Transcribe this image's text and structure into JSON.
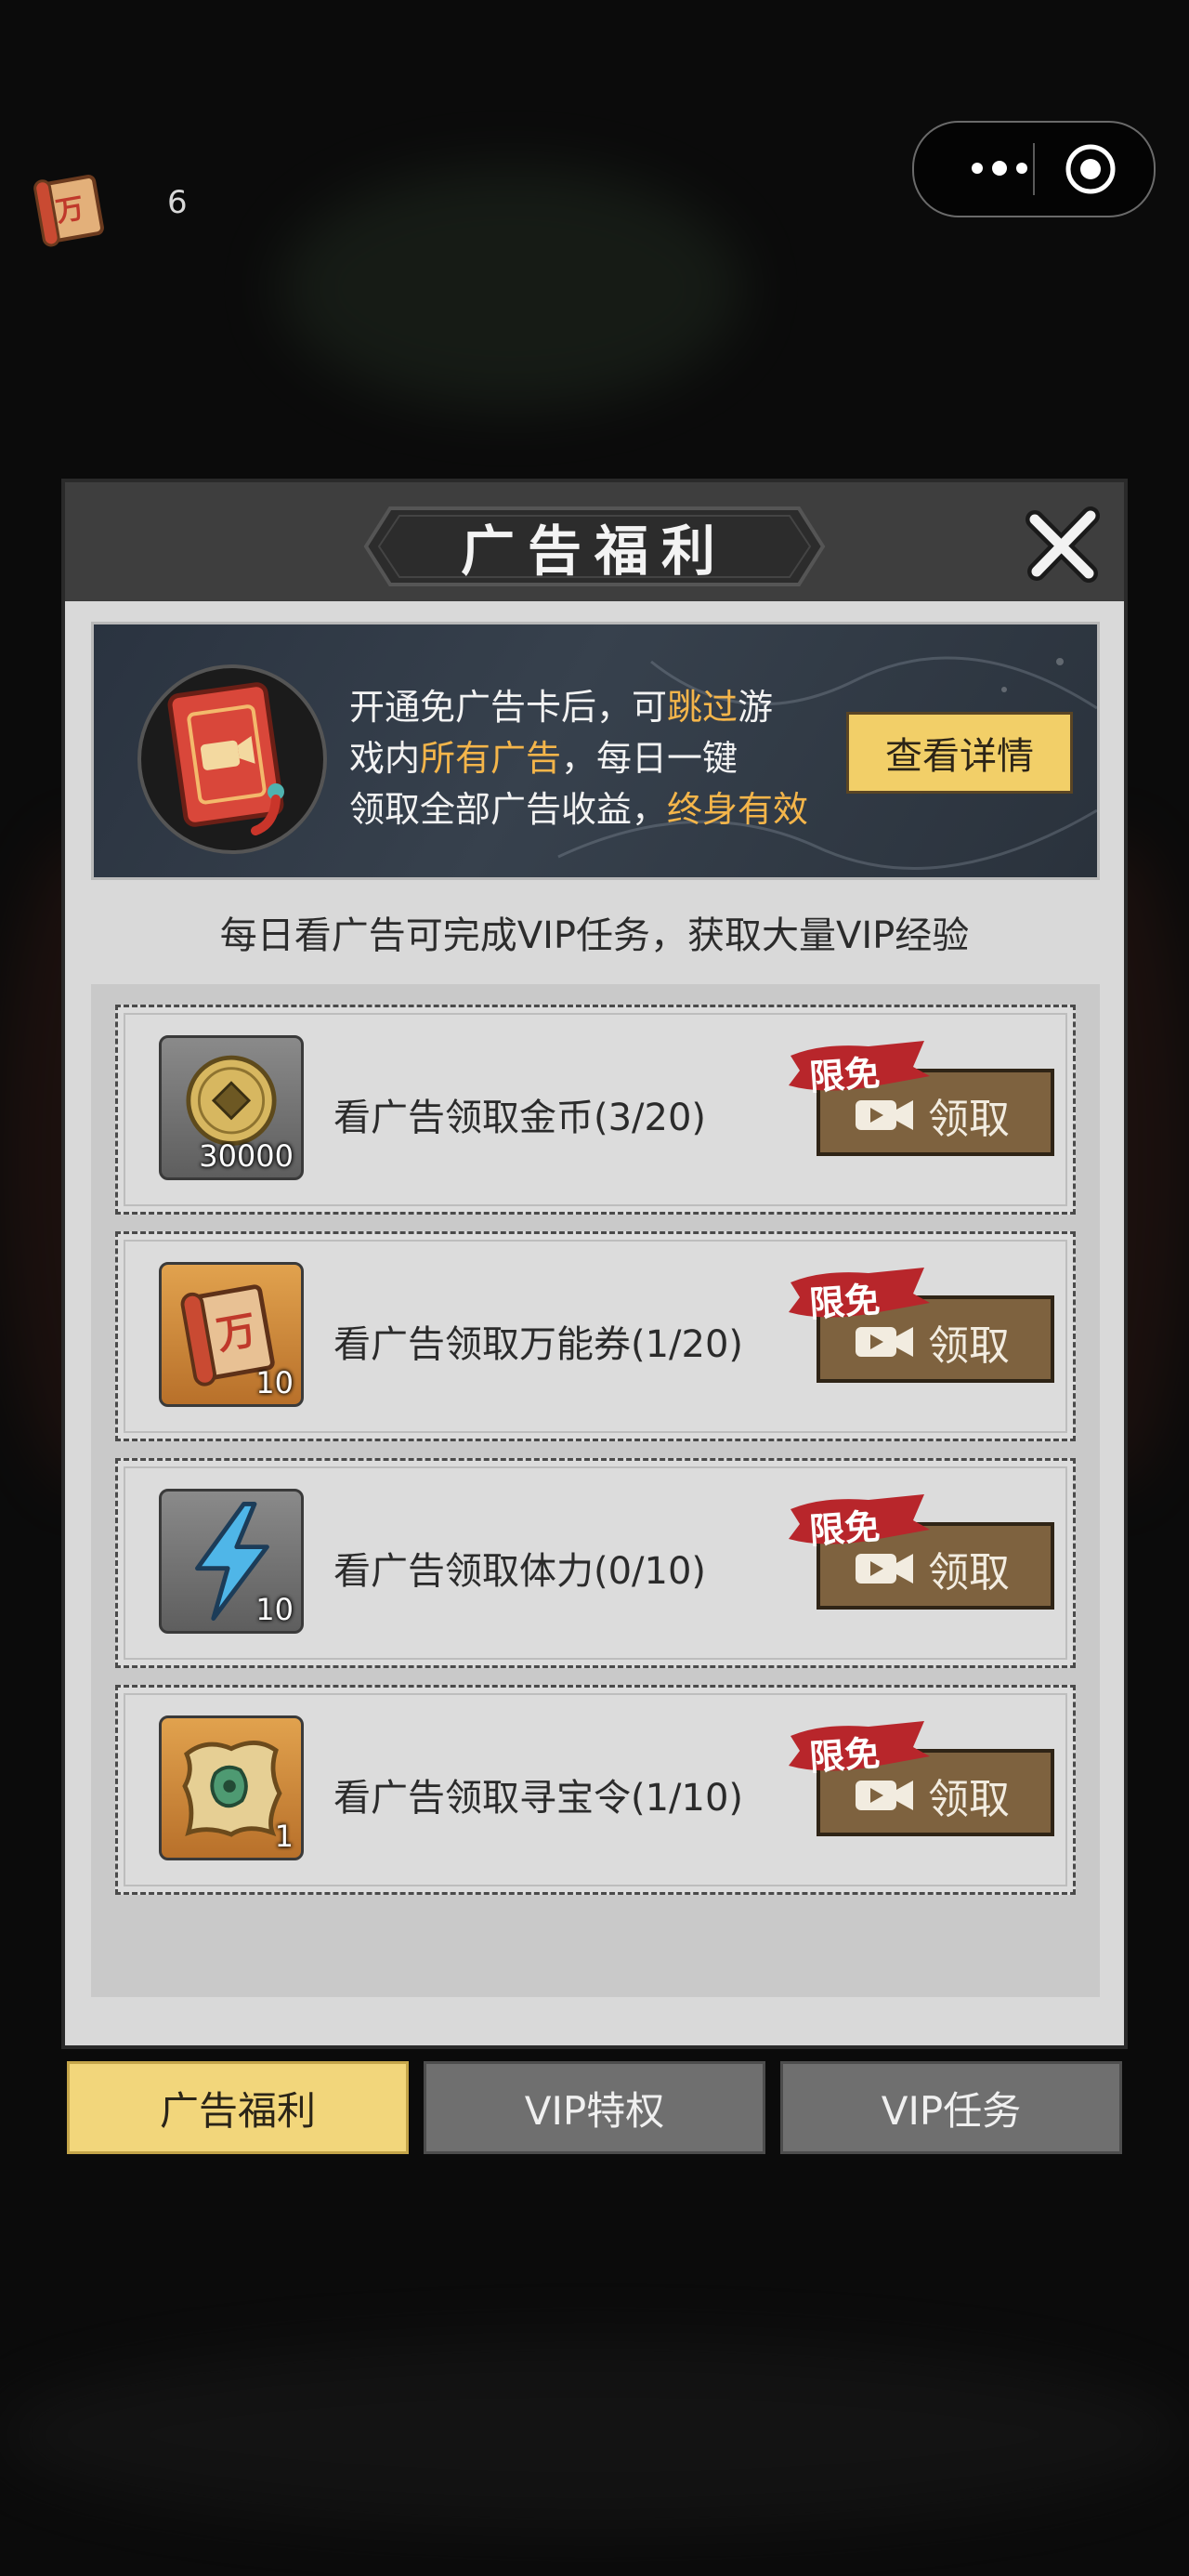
{
  "top": {
    "currency_count": "6"
  },
  "dialog": {
    "title": "广告福利",
    "banner": {
      "line1_a": "开通免广告卡后，可",
      "line1_hl": "跳过",
      "line1_b": "游",
      "line2_a": "戏内",
      "line2_hl": "所有广告",
      "line2_b": "，每日一键",
      "line3_a": "领取全部广告收益，",
      "line3_hl": "终身有效",
      "detail_button": "查看详情"
    },
    "notice": "每日看广告可完成VIP任务，获取大量VIP经验",
    "free_tag": "限免",
    "claim_label": "领取",
    "rewards": [
      {
        "label": "看广告领取金币(3/20)",
        "qty": "30000",
        "icon": "coin-icon"
      },
      {
        "label": "看广告领取万能券(1/20)",
        "qty": "10",
        "icon": "scroll-ticket-icon"
      },
      {
        "label": "看广告领取体力(0/10)",
        "qty": "10",
        "icon": "lightning-icon"
      },
      {
        "label": "看广告领取寻宝令(1/10)",
        "qty": "1",
        "icon": "treasure-map-icon"
      }
    ]
  },
  "tabs": [
    {
      "label": "广告福利",
      "active": true
    },
    {
      "label": "VIP特权",
      "active": false
    },
    {
      "label": "VIP任务",
      "active": false
    }
  ],
  "colors": {
    "highlight": "#f4b54a",
    "tab_active": "#f2d67b",
    "claim_button": "#7e623f",
    "free_tag": "#b8262b"
  }
}
